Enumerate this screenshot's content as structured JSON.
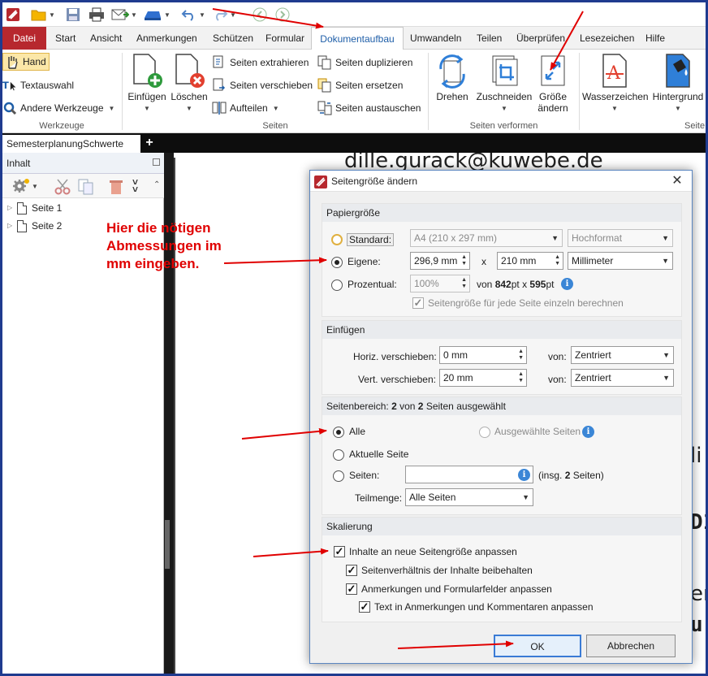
{
  "qat": {
    "icons": [
      "app-logo-icon",
      "open-folder-icon",
      "save-icon",
      "print-icon",
      "email-icon",
      "scan-icon",
      "undo-icon",
      "redo-icon",
      "back-icon",
      "forward-icon"
    ]
  },
  "tabs": {
    "file": "Datei",
    "items": [
      "Start",
      "Ansicht",
      "Anmerkungen",
      "Schützen",
      "Formular",
      "Dokumentaufbau",
      "Umwandeln",
      "Teilen",
      "Überprüfen",
      "Lesezeichen",
      "Hilfe"
    ],
    "active": "Dokumentaufbau"
  },
  "ribbon": {
    "werkzeuge": {
      "hand": "Hand",
      "textauswahl": "Textauswahl",
      "andere": "Andere Werkzeuge",
      "label": "Werkzeuge"
    },
    "seiten": {
      "einfuegen": "Einfügen",
      "loeschen": "Löschen",
      "extrahieren": "Seiten extrahieren",
      "verschieben": "Seiten verschieben",
      "aufteilen": "Aufteilen",
      "duplizieren": "Seiten duplizieren",
      "ersetzen": "Seiten ersetzen",
      "austauschen": "Seiten austauschen",
      "label": "Seiten"
    },
    "verformen": {
      "drehen": "Drehen",
      "zuschneiden": "Zuschneiden",
      "groesse1": "Größe",
      "groesse2": "ändern",
      "label": "Seiten verformen"
    },
    "hintergrund": {
      "wasserzeichen": "Wasserzeichen",
      "hintergrund": "Hintergrund",
      "label": "Seite"
    }
  },
  "doctab": {
    "title": "SemesterplanungSchwerte",
    "add": "+"
  },
  "leftpanel": {
    "title": "Inhalt",
    "pages": [
      "Seite 1",
      "Seite 2"
    ]
  },
  "document": {
    "line1": "dille.gurack@kuwebe.de",
    "frag1": "li",
    "frag2": "D1",
    "frag3": "er",
    "frag4": "u"
  },
  "annotation": {
    "lines": [
      "Hier die nötigen",
      "Abmessungen im",
      "mm eingeben."
    ],
    "color": "#e00000"
  },
  "dialog": {
    "title": "Seitengröße ändern",
    "close": "✕",
    "papier": {
      "title": "Papiergröße",
      "standard_label": "Standard:",
      "standard_value": "A4 (210 x 297 mm)",
      "orientation": "Hochformat",
      "eigene_label": "Eigene:",
      "width": "296,9 mm",
      "x": "x",
      "height": "210 mm",
      "unit": "Millimeter",
      "prozent_label": "Prozentual:",
      "prozent_value": "100%",
      "von_prefix": "von",
      "pt_w": "842",
      "pt_x": "pt x",
      "pt_h": "595",
      "pt_suffix": "pt",
      "each_page": "Seitengröße für jede Seite einzeln berechnen"
    },
    "einfuegen": {
      "title": "Einfügen",
      "horiz_label": "Horiz. verschieben:",
      "horiz_value": "0 mm",
      "vert_label": "Vert. verschieben:",
      "vert_value": "20 mm",
      "von1": "von:",
      "von1_value": "Zentriert",
      "von2": "von:",
      "von2_value": "Zentriert"
    },
    "bereich": {
      "title_pre": "Seitenbereich:",
      "count": "2",
      "title_mid": "von",
      "total": "2",
      "title_post": "Seiten ausgewählt",
      "alle": "Alle",
      "ausgewaehlte": "Ausgewählte Seiten",
      "aktuelle": "Aktuelle Seite",
      "seiten": "Seiten:",
      "insg_pre": "(insg.",
      "insg_n": "2",
      "insg_post": "Seiten)",
      "teilmenge_label": "Teilmenge:",
      "teilmenge_value": "Alle Seiten"
    },
    "skalierung": {
      "title": "Skalierung",
      "c1": "Inhalte an neue Seitengröße anpassen",
      "c2": "Seitenverhältnis der Inhalte beibehalten",
      "c3": "Anmerkungen und Formularfelder anpassen",
      "c4": "Text in Anmerkungen und Kommentaren anpassen"
    },
    "ok": "OK",
    "cancel": "Abbrechen"
  },
  "colors": {
    "frame": "#1f3b8f",
    "file_tab": "#b7282e",
    "accent": "#1e5ea8",
    "arrow": "#e00000"
  }
}
